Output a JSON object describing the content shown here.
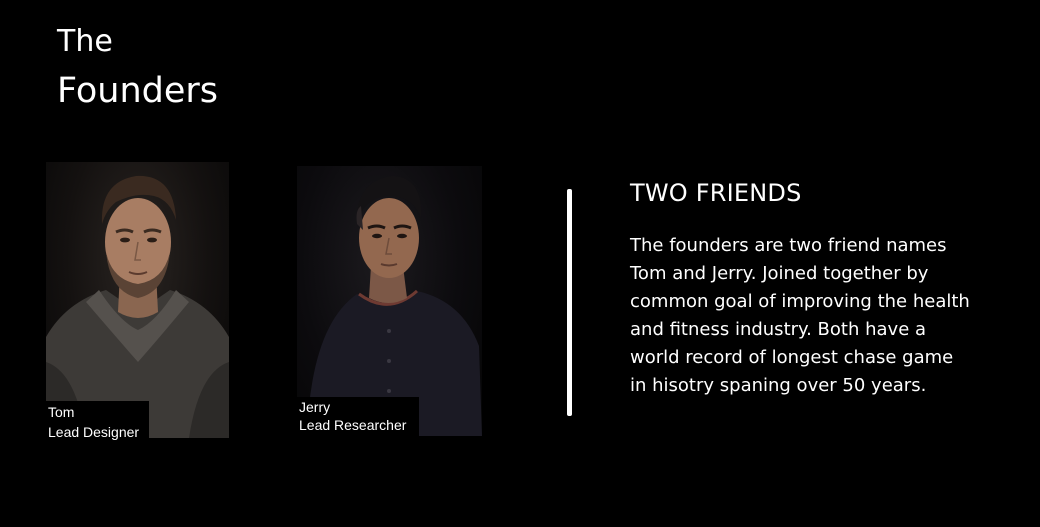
{
  "header": {
    "title_line1": "The",
    "title_line2": "Founders"
  },
  "founders": [
    {
      "name": "Tom",
      "role": "Lead Designer"
    },
    {
      "name": "Jerry",
      "role": "Lead Researcher"
    }
  ],
  "about": {
    "heading": "TWO FRIENDS",
    "body": "The founders are two friend names Tom and Jerry. Joined together by common goal of improving the health and fitness industry. Both have a world record of longest chase game in hisotry spaning over 50 years."
  },
  "colors": {
    "background": "#000000",
    "text": "#ffffff"
  }
}
